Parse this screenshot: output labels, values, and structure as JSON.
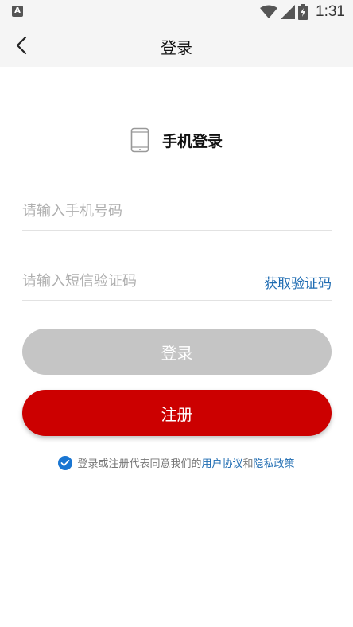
{
  "status_bar": {
    "time": "1:31",
    "left_badge": "A"
  },
  "header": {
    "title": "登录"
  },
  "section": {
    "title": "手机登录"
  },
  "form": {
    "phone_placeholder": "请输入手机号码",
    "code_placeholder": "请输入短信验证码",
    "get_code_label": "获取验证码"
  },
  "buttons": {
    "login_label": "登录",
    "register_label": "注册"
  },
  "agreement": {
    "prefix": "登录或注册代表同意我们的",
    "user_agreement": "用户协议",
    "conjunction": "和",
    "privacy_policy": "隐私政策"
  },
  "colors": {
    "accent": "#cc0000",
    "link": "#1f6cb2",
    "disabled": "#c5c5c5",
    "check": "#1a76d2"
  }
}
